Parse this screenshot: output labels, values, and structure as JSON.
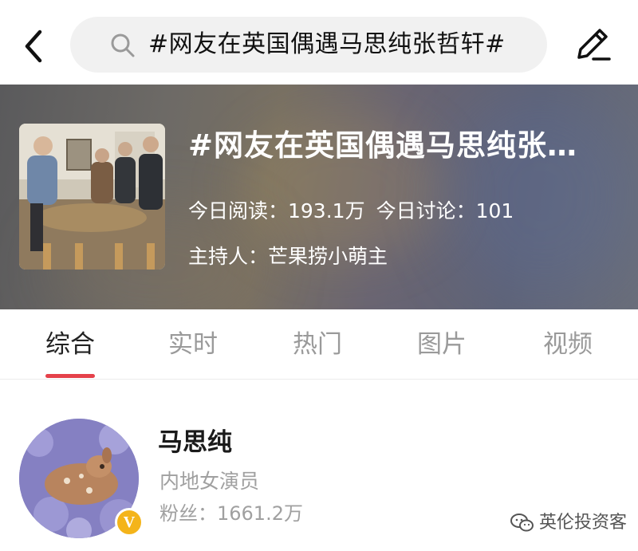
{
  "search": {
    "query": "#网友在英国偶遇马思纯张哲轩#"
  },
  "hero": {
    "title": "#网友在英国偶遇马思纯张…",
    "read_today": "今日阅读：193.1万",
    "discuss_today": "今日讨论：101",
    "host": "主持人：芒果捞小萌主"
  },
  "tabs": [
    {
      "label": "综合",
      "active": true
    },
    {
      "label": "实时"
    },
    {
      "label": "热门"
    },
    {
      "label": "图片"
    },
    {
      "label": "视频"
    }
  ],
  "user": {
    "name": "马思纯",
    "description": "内地女演员",
    "fans": "粉丝：1661.2万",
    "badge": "V"
  },
  "watermark": {
    "text": "英伦投资客"
  },
  "colors": {
    "accent": "#e5414a",
    "badge": "#f4b41a",
    "search_bg": "#f1f1f1"
  },
  "icons": [
    "back-icon",
    "search-icon",
    "edit-icon",
    "verified-badge-icon",
    "wechat-icon"
  ]
}
